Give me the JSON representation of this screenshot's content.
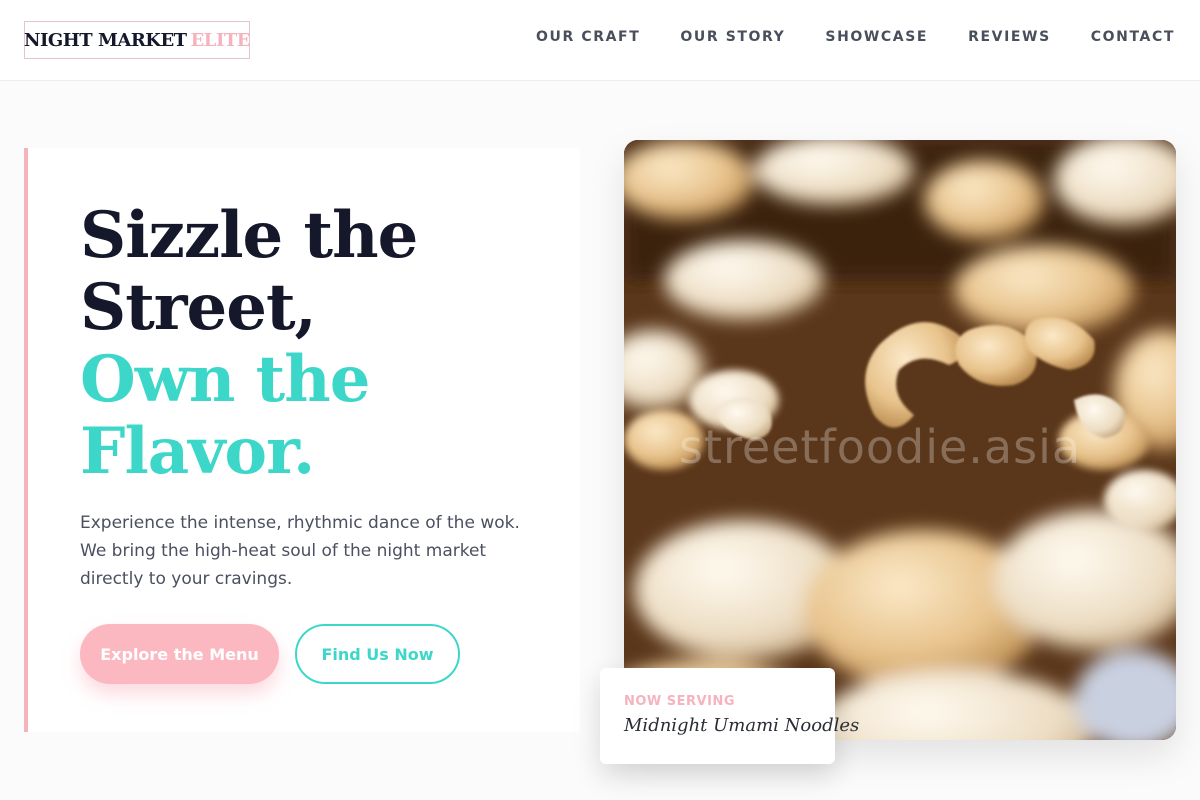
{
  "header": {
    "logo_main": "NIGHT MARKET",
    "logo_accent": "ELITE",
    "nav": [
      "OUR CRAFT",
      "OUR STORY",
      "SHOWCASE",
      "REVIEWS",
      "CONTACT"
    ]
  },
  "hero": {
    "headline_line1": "Sizzle the",
    "headline_line2": "Street,",
    "headline_line3": "Own the",
    "headline_line4": "Flavor.",
    "subtext": "Experience the intense, rhythmic dance of the wok. We bring the high-heat soul of the night market directly to your cravings.",
    "primary_button": "Explore the Menu",
    "secondary_button": "Find Us Now"
  },
  "photo": {
    "watermark": "streetfoodie.asia",
    "subject": "cashew-nuts-photo"
  },
  "serving": {
    "label": "NOW SERVING",
    "item": "Midnight Umami Noodles"
  },
  "colors": {
    "accent_pink": "#f5b3be",
    "accent_teal": "#3cd7c9",
    "text_dark": "#14182a"
  }
}
